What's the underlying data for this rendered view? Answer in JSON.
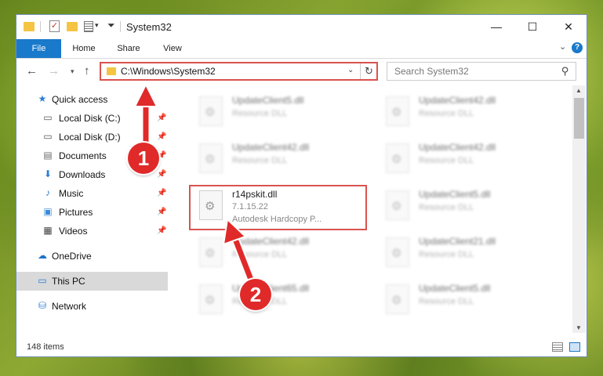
{
  "window": {
    "title": "System32",
    "controls": {
      "minimize": "—",
      "maximize": "☐",
      "close": "✕"
    }
  },
  "quick_access_toolbar": {
    "dropdown_glyph": "▾",
    "customize_glyph": "⏷"
  },
  "ribbon": {
    "tabs": [
      {
        "label": "File"
      },
      {
        "label": "Home"
      },
      {
        "label": "Share"
      },
      {
        "label": "View"
      }
    ],
    "help_glyph": "?",
    "expand_glyph": "⌄"
  },
  "navigation": {
    "back": "←",
    "forward": "→",
    "recent": "▾",
    "up": "↑",
    "address": "C:\\Windows\\System32",
    "address_dropdown": "⌄",
    "refresh": "↻",
    "search_placeholder": "Search System32",
    "search_glyph": "⚲"
  },
  "sidebar": {
    "items": [
      {
        "label": "Quick access",
        "icon": "star-icon",
        "glyph": "★",
        "color": "#2b7cd3"
      },
      {
        "label": "Local Disk (C:)",
        "icon": "drive-icon",
        "glyph": "▭",
        "color": "#555555"
      },
      {
        "label": "Local Disk (D:)",
        "icon": "drive-icon",
        "glyph": "▭",
        "color": "#555555"
      },
      {
        "label": "Documents",
        "icon": "documents-icon",
        "glyph": "▤",
        "color": "#6b6b6b"
      },
      {
        "label": "Downloads",
        "icon": "download-icon",
        "glyph": "⬇",
        "color": "#2b7cd3"
      },
      {
        "label": "Music",
        "icon": "music-icon",
        "glyph": "♪",
        "color": "#2b7cd3"
      },
      {
        "label": "Pictures",
        "icon": "pictures-icon",
        "glyph": "▣",
        "color": "#3a8ad6"
      },
      {
        "label": "Videos",
        "icon": "videos-icon",
        "glyph": "▦",
        "color": "#444444"
      },
      {
        "label": "OneDrive",
        "icon": "cloud-icon",
        "glyph": "☁",
        "color": "#1e73c8"
      },
      {
        "label": "This PC",
        "icon": "computer-icon",
        "glyph": "▭",
        "color": "#2b7cd3"
      },
      {
        "label": "Network",
        "icon": "network-icon",
        "glyph": "⛁",
        "color": "#2b7cd3"
      }
    ],
    "pin_glyph": "📌"
  },
  "files": [
    {
      "name": "UpdateClient5.dll",
      "type": "Resource DLL"
    },
    {
      "name": "UpdateClient42.dll",
      "type": "Resource DLL"
    },
    {
      "name": "UpdateClient42.dll",
      "type": "Resource DLL"
    },
    {
      "name": "UpdateClient42.dll",
      "type": "Resource DLL"
    },
    {
      "name": "r14pskit.dll",
      "version": "7.1.15.22",
      "type": "Autodesk Hardcopy P..."
    },
    {
      "name": "UpdateClient5.dll",
      "type": "Resource DLL"
    },
    {
      "name": "UpdateClient42.dll",
      "type": "Resource DLL"
    },
    {
      "name": "UpdateClient21.dll",
      "type": "Resource DLL"
    },
    {
      "name": "UpdateClient65.dll",
      "type": "Resource DLL"
    },
    {
      "name": "UpdateClient5.dll",
      "type": "Resource DLL"
    }
  ],
  "status": {
    "item_count": "148 items"
  },
  "callouts": {
    "one": "1",
    "two": "2"
  },
  "colors": {
    "accent": "#1979ca",
    "highlight": "#d9534f",
    "callout": "#e02a2a"
  }
}
